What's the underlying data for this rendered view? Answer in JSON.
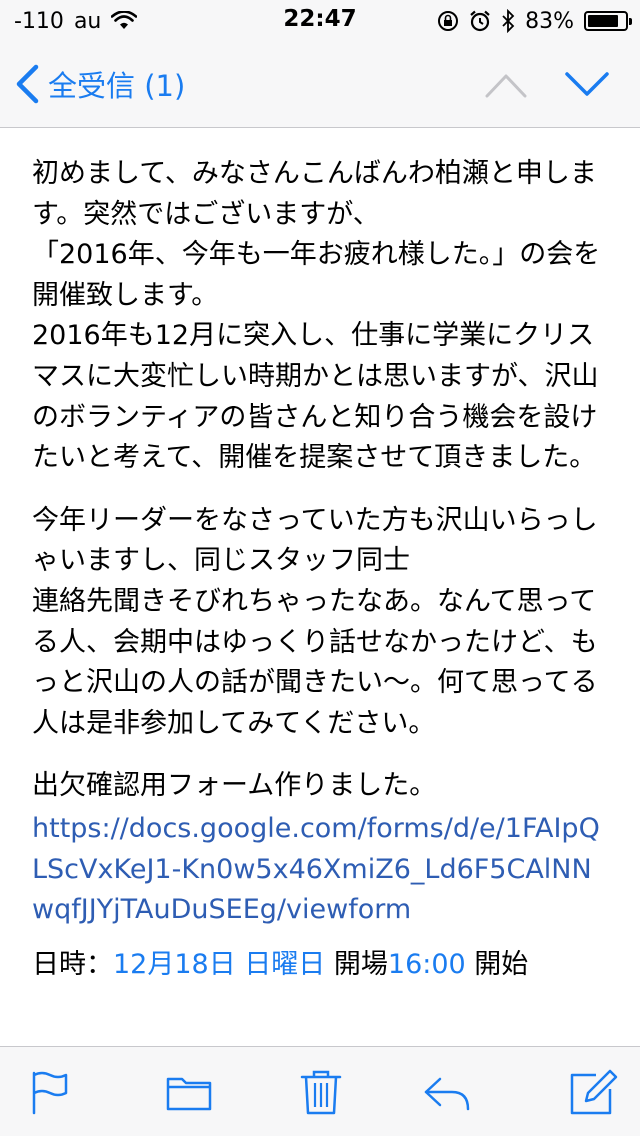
{
  "status_bar": {
    "signal": "-110",
    "carrier": "au",
    "time": "22:47",
    "battery_percent": "83%",
    "battery_level": 0.83
  },
  "nav": {
    "back_label": "全受信 (1)"
  },
  "email": {
    "para1": "初めまして、みなさんこんばんわ柏瀬と申します。突然ではございますが、\n「2016年、今年も一年お疲れ様した。」の会を開催致します。\n2016年も12月に突入し、仕事に学業にクリスマスに大変忙しい時期かとは思いますが、沢山のボランティアの皆さんと知り合う機会を設けたいと考えて、開催を提案させて頂きました。",
    "para2": "今年リーダーをなさっていた方も沢山いらっしゃいますし、同じスタッフ同士\n連絡先聞きそびれちゃったなあ。なんて思ってる人、会期中はゆっくり話せなかったけど、もっと沢山の人の話が聞きたい〜。何て思ってる人は是非参加してみてください。",
    "para3_text": "出欠確認用フォーム作りました。",
    "form_link": "https://docs.google.com/forms/d/e/1FAIpQLScVxKeJ1-Kn0w5x46XmiZ6_Ld6F5CAlNNwqfJJYjTAuDuSEEg/viewform",
    "cutoff_label": "日時：",
    "cutoff_date": "12月18日 日曜日",
    "cutoff_mid": " 開場",
    "cutoff_time": "16:00",
    "cutoff_end": " 開始"
  },
  "colors": {
    "accent": "#1a7cf0",
    "link": "#2e5db3"
  }
}
